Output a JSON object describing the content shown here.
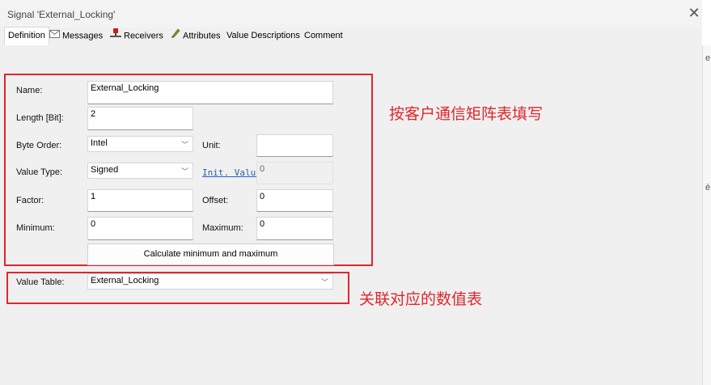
{
  "window": {
    "title": "Signal 'External_Locking'",
    "close_icon": "close-icon"
  },
  "tabs": [
    {
      "label": "Definition",
      "icon": ""
    },
    {
      "label": "Messages",
      "icon": "envelope-icon"
    },
    {
      "label": "Receivers",
      "icon": "receiver-node-icon"
    },
    {
      "label": "Attributes",
      "icon": "pencil-icon"
    },
    {
      "label": "Value Descriptions",
      "icon": ""
    },
    {
      "label": "Comment",
      "icon": ""
    }
  ],
  "form": {
    "name_label": "Name:",
    "name_value": "External_Locking",
    "length_label": "Length [Bit]:",
    "length_value": "2",
    "byte_order_label": "Byte Order:",
    "byte_order_value": "Intel",
    "unit_label": "Unit:",
    "unit_value": "",
    "value_type_label": "Value Type:",
    "value_type_value": "Signed",
    "init_value_link": "Init. Value",
    "init_value": "0",
    "factor_label": "Factor:",
    "factor_value": "1",
    "offset_label": "Offset:",
    "offset_value": "0",
    "minimum_label": "Minimum:",
    "minimum_value": "0",
    "maximum_label": "Maximum:",
    "maximum_value": "0",
    "calculate_button": "Calculate minimum and maximum",
    "value_table_label": "Value Table:",
    "value_table_value": "External_Locking"
  },
  "annotations": {
    "box1_note": "按客户通信矩阵表填写",
    "box2_note": "关联对应的数值表",
    "color": "#e0262c"
  },
  "edge_glyphs": [
    "e",
    "è"
  ]
}
